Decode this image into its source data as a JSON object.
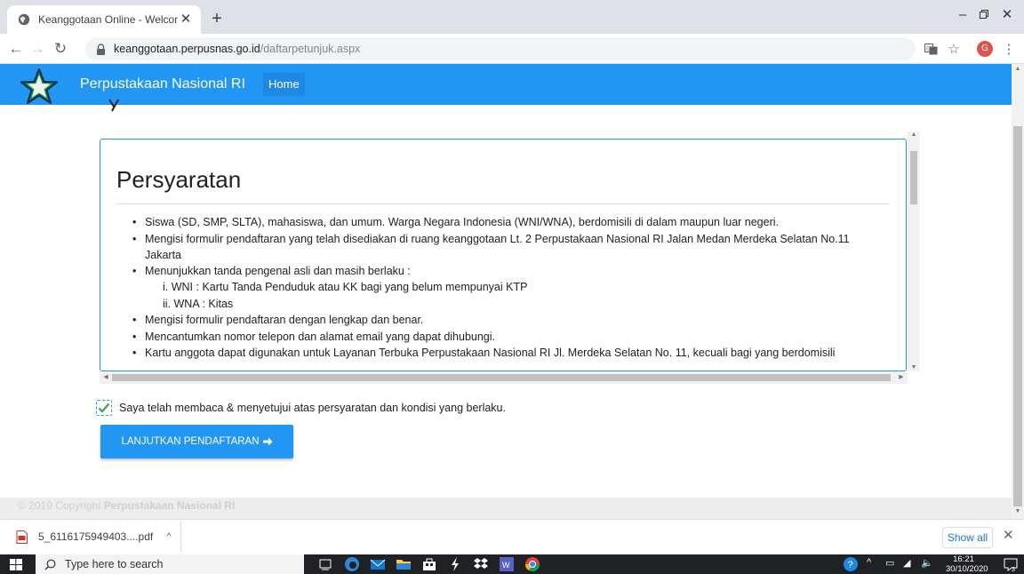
{
  "browser": {
    "tab_title": "Keanggotaan Online - Welcome",
    "url_domain": "keanggotaan.perpusnas.go.id",
    "url_path": "/daftarpetunjuk.aspx",
    "profile_initial": "G"
  },
  "site": {
    "brand": "Perpustakaan Nasional RI",
    "nav_home": "Home",
    "accent_color": "#2196f3"
  },
  "terms": {
    "title": "Persyaratan",
    "items": [
      "Siswa (SD, SMP, SLTA), mahasiswa, dan umum. Warga Negara Indonesia (WNI/WNA), berdomisili di dalam maupun luar negeri.",
      "Mengisi formulir pendaftaran yang telah disediakan di ruang keanggotaan Lt. 2  Perpustakaan Nasional RI Jalan Medan Merdeka Selatan No.11 Jakarta",
      "Menunjukkan tanda pengenal asli dan masih berlaku :",
      "Mengisi formulir pendaftaran dengan lengkap dan benar.",
      "Mencantumkan nomor telepon dan alamat email yang dapat dihubungi.",
      "Kartu anggota dapat digunakan untuk Layanan Terbuka Perpustakaan Nasional RI Jl. Merdeka Selatan No. 11, kecuali bagi yang berdomisili"
    ],
    "id_subitems": [
      "i. WNI : Kartu Tanda Penduduk atau KK bagi yang belum mempunyai KTP",
      "ii. WNA : Kitas"
    ]
  },
  "agreement": {
    "label": "Saya telah membaca & menyetujui atas persyaratan dan kondisi yang berlaku.",
    "checked": true
  },
  "continue_button": {
    "label": "LANJUTKAN PENDAFTARAN"
  },
  "footer": {
    "prefix": "© 2019 Copyright",
    "org": "Perpustakaan Nasional RI"
  },
  "downloads": {
    "file_name": "5_6116175949403....pdf",
    "show_all": "Show all"
  },
  "taskbar": {
    "search_placeholder": "Type here to search",
    "time": "16:21",
    "date": "30/10/2020"
  }
}
